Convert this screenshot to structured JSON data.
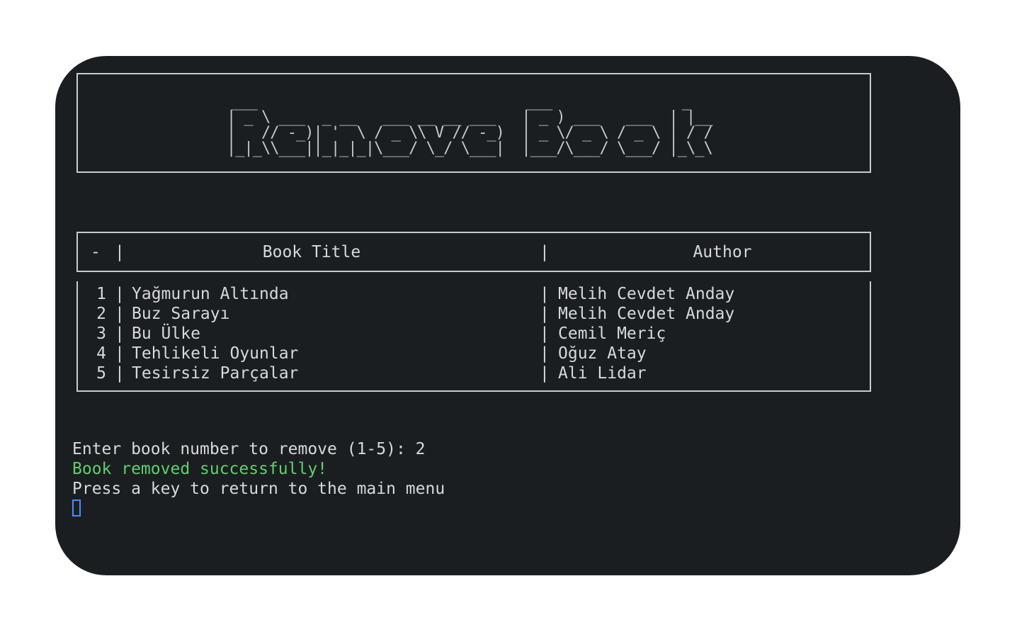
{
  "banner": {
    "title": "Remove Book",
    "ascii_lines": [
      " ___                               ___               _    ",
      "| _ \\ ___  _ __   ___ __ __ ___   | _ ) ___   ___  | |__ ",
      "|   // -_)| '  \\ / _ \\\\ V // -_)  | _ \\/ _ \\ / _ \\ | / / ",
      "|_|_\\\\___||_|_|_|\\___/ \\_/ \\___|  |___/\\___/ \\___/ |_\\_\\ "
    ]
  },
  "table": {
    "header": {
      "number": "-",
      "separator": "|",
      "title": "Book Title",
      "author": "Author"
    },
    "rows": [
      {
        "number": "1",
        "title": "Yağmurun Altında",
        "author": "Melih Cevdet Anday"
      },
      {
        "number": "2",
        "title": "Buz Sarayı",
        "author": "Melih Cevdet Anday"
      },
      {
        "number": "3",
        "title": "Bu Ülke",
        "author": "Cemil Meriç"
      },
      {
        "number": "4",
        "title": "Tehlikeli Oyunlar",
        "author": "Oğuz Atay"
      },
      {
        "number": "5",
        "title": "Tesirsiz Parçalar",
        "author": "Ali Lidar"
      }
    ]
  },
  "console": {
    "prompt": "Enter book number to remove (1-5): 2",
    "success": "Book removed successfully!",
    "continue_hint": "Press a key to return to the main menu"
  },
  "colors": {
    "background": "#1b1e21",
    "text": "#d7d8da",
    "success": "#5fd06c",
    "cursor": "#4a8cff"
  }
}
